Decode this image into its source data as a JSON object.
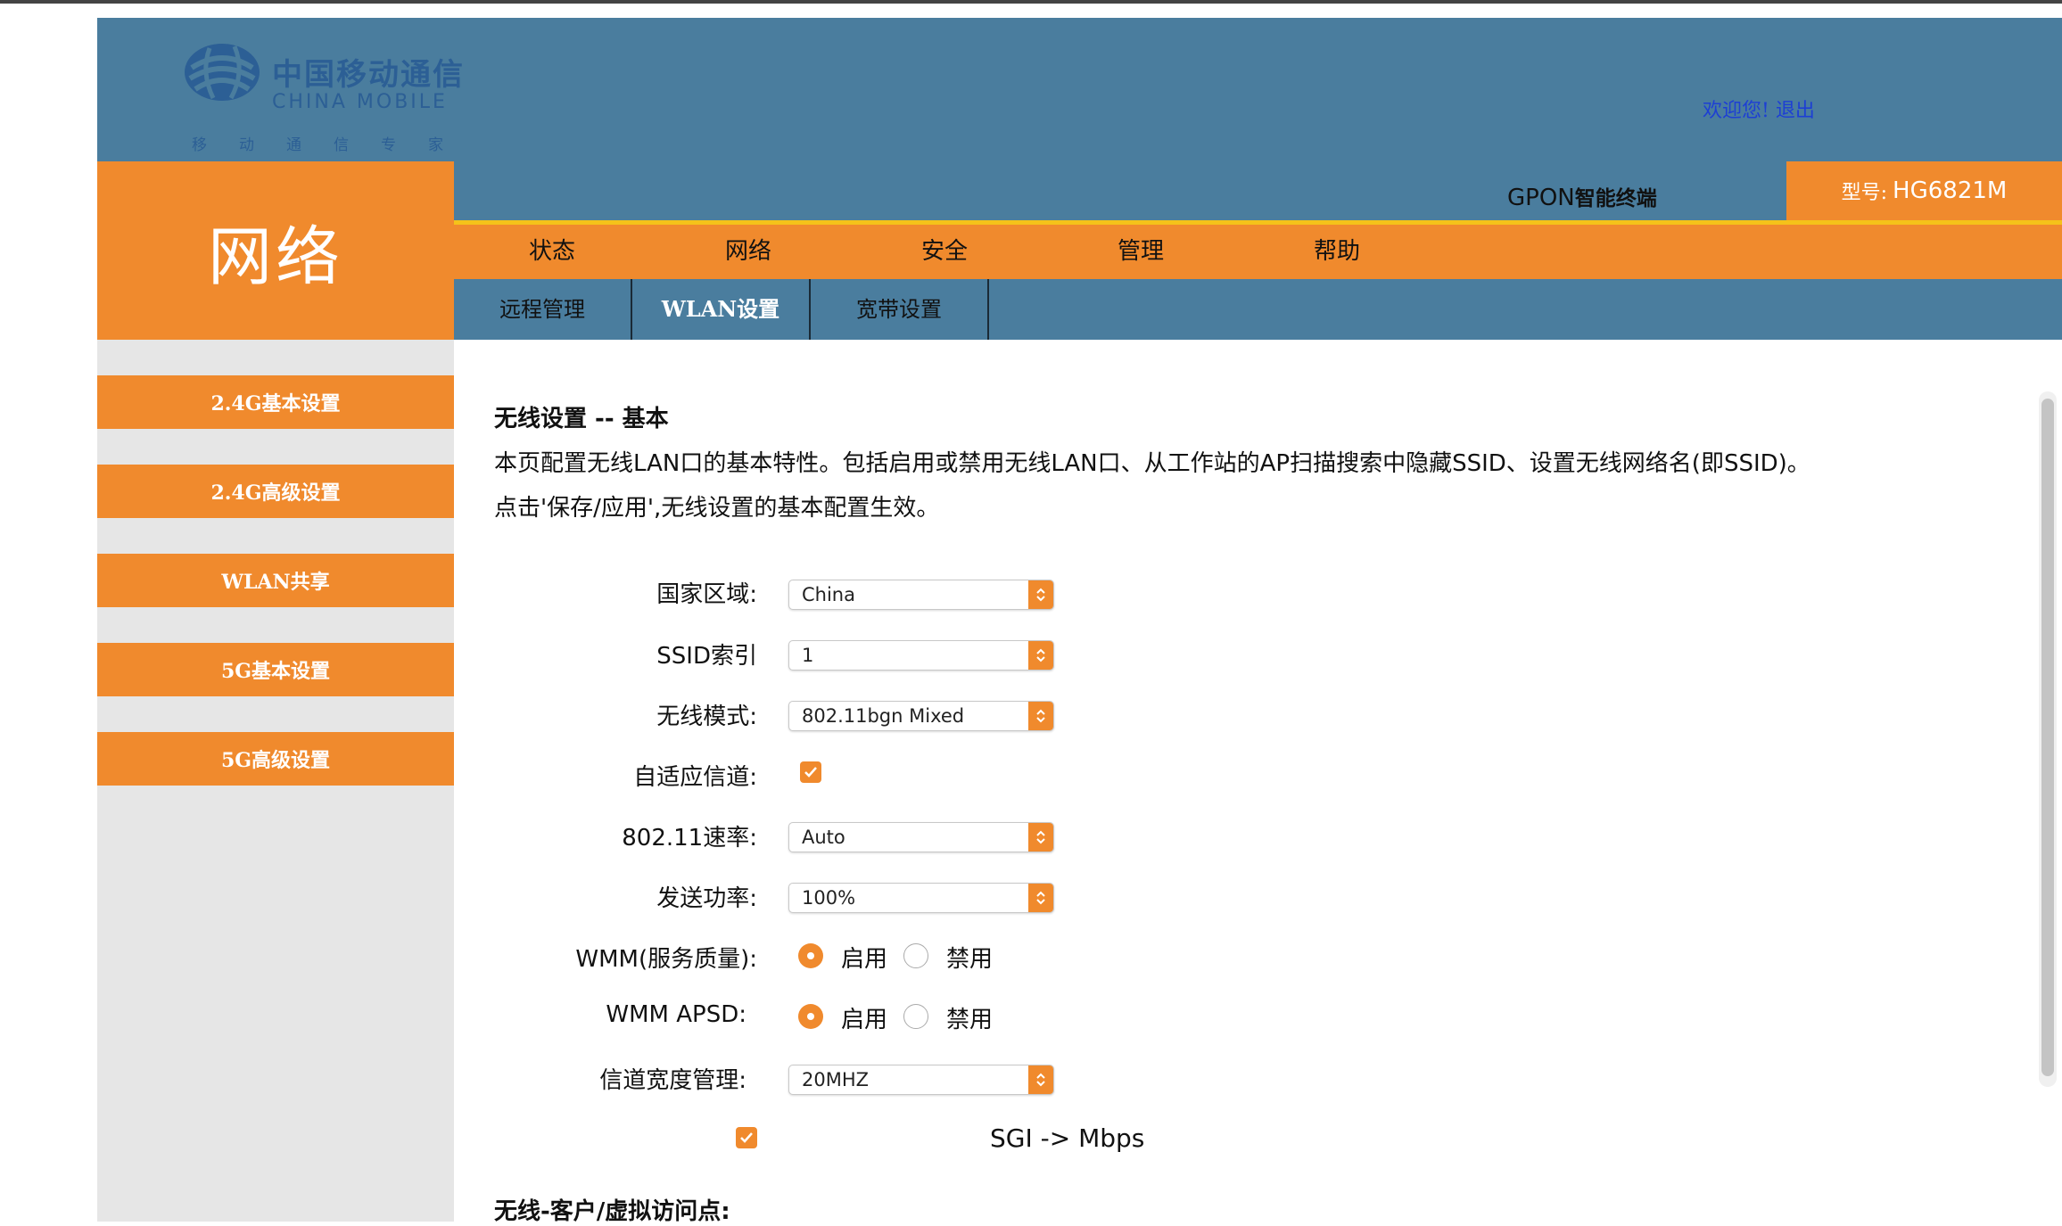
{
  "header": {
    "logo_cn": "中国移动通信",
    "logo_en": "CHINA MOBILE",
    "logo_sub": "移动通信专家",
    "welcome": "欢迎您!",
    "logout": "退出"
  },
  "section_title": "网络",
  "device": {
    "gpon": "GPON",
    "gpon_suffix": "智能终端",
    "model_label": "型号:",
    "model": "HG6821M"
  },
  "main_nav": [
    "状态",
    "网络",
    "安全",
    "管理",
    "帮助"
  ],
  "sub_nav": [
    {
      "label": "远程管理",
      "active": false
    },
    {
      "label": "WLAN设置",
      "active": true
    },
    {
      "label": "宽带设置",
      "active": false
    }
  ],
  "sidebar": [
    "2.4G基本设置",
    "2.4G高级设置",
    "WLAN共享",
    "5G基本设置",
    "5G高级设置"
  ],
  "content": {
    "title": "无线设置 -- 基本",
    "desc_line1": "本页配置无线LAN口的基本特性。包括启用或禁用无线LAN口、从工作站的AP扫描搜索中隐藏SSID、设置无线网络名(即SSID)。",
    "desc_line2": "点击'保存/应用',无线设置的基本配置生效。",
    "fields": {
      "country": {
        "label": "国家区域:",
        "value": "China"
      },
      "ssid_index": {
        "label": "SSID索引",
        "value": "1"
      },
      "mode": {
        "label": "无线模式:",
        "value": "802.11bgn Mixed"
      },
      "auto_channel": {
        "label": "自适应信道:",
        "checked": true
      },
      "rate": {
        "label": "802.11速率:",
        "value": "Auto"
      },
      "power": {
        "label": "发送功率:",
        "value": "100%"
      },
      "wmm": {
        "label": "WMM(服务质量):",
        "on": "启用",
        "off": "禁用",
        "selected": "启用"
      },
      "wmm_apsd": {
        "label": "WMM APSD:",
        "on": "启用",
        "off": "禁用",
        "selected": "启用"
      },
      "bandwidth": {
        "label": "信道宽度管理:",
        "value": "20MHZ"
      },
      "sgi": {
        "label": "SGI -> Mbps",
        "checked": true
      }
    },
    "section2_title": "无线-客户/虚拟访问点:"
  },
  "colors": {
    "accent": "#f08a2d",
    "header_blue": "#4a7d9e",
    "stripe": "#f5c21a",
    "link": "#1d3fd4"
  }
}
